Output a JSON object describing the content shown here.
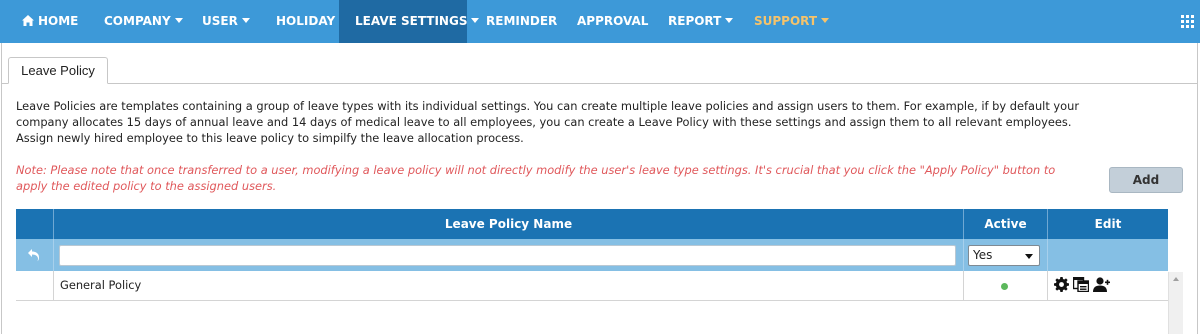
{
  "nav": {
    "items": [
      {
        "label": "HOME",
        "icon": "home-icon"
      },
      {
        "label": "COMPANY",
        "dropdown": true
      },
      {
        "label": "USER",
        "dropdown": true
      },
      {
        "label": "HOLIDAY"
      },
      {
        "label": "LEAVE SETTINGS",
        "dropdown": true,
        "active": true
      },
      {
        "label": "REMINDER"
      },
      {
        "label": "APPROVAL"
      },
      {
        "label": "REPORT",
        "dropdown": true
      },
      {
        "label": "SUPPORT",
        "dropdown": true,
        "highlight": true
      }
    ],
    "apps_icon": "apps-grid-icon"
  },
  "tab": {
    "label": "Leave Policy"
  },
  "description": "Leave Policies are templates containing a group of leave types with its individual settings. You can create multiple leave policies and assign users to them. For example, if by default your company allocates 15 days of annual leave and 14 days of medical leave to all employees, you can create a Leave Policy with these settings and assign them to all relevant employees. Assign newly hired employee to this leave policy to simpilfy the leave allocation process.",
  "note": "Note: Please note that once transferred to a user, modifying a leave policy will not directly modify the user's leave type settings. It's crucial that you click the \"Apply Policy\" button to apply the edited policy to the assigned users.",
  "add_button": "Add",
  "grid": {
    "columns": {
      "name": "Leave Policy Name",
      "active": "Active",
      "edit": "Edit"
    },
    "filter": {
      "name_value": "",
      "active_value": "Yes"
    },
    "rows": [
      {
        "name": "General Policy",
        "active": true
      }
    ]
  },
  "colors": {
    "nav_bg": "#3d99d8",
    "nav_active": "#1f6aa3",
    "support": "#f5c36b",
    "grid_header": "#1b73b3",
    "filter_row": "#85bfe4",
    "note": "#e0585b",
    "active_dot": "#5cb85c"
  }
}
